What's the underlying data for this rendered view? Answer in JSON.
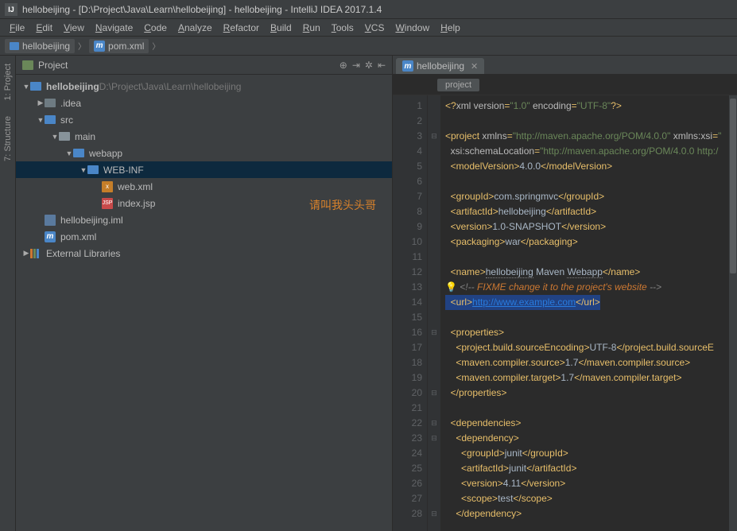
{
  "title": "hellobeijing - [D:\\Project\\Java\\Learn\\hellobeijing] - hellobeijing - IntelliJ IDEA 2017.1.4",
  "menu": [
    "File",
    "Edit",
    "View",
    "Navigate",
    "Code",
    "Analyze",
    "Refactor",
    "Build",
    "Run",
    "Tools",
    "VCS",
    "Window",
    "Help"
  ],
  "breadcrumbs": [
    {
      "icon": "dir",
      "label": "hellobeijing"
    },
    {
      "icon": "m",
      "label": "pom.xml"
    }
  ],
  "side_tabs": [
    "1: Project",
    "7: Structure"
  ],
  "panel": {
    "title": "Project"
  },
  "tree": [
    {
      "depth": 0,
      "arrow": "▼",
      "icon": "folder-blue",
      "label": "hellobeijing",
      "suffix": "D:\\Project\\Java\\Learn\\hellobeijing",
      "bold": true
    },
    {
      "depth": 1,
      "arrow": "▶",
      "icon": "folder-dark",
      "label": ".idea"
    },
    {
      "depth": 1,
      "arrow": "▼",
      "icon": "folder-blue",
      "label": "src"
    },
    {
      "depth": 2,
      "arrow": "▼",
      "icon": "folder",
      "label": "main"
    },
    {
      "depth": 3,
      "arrow": "▼",
      "icon": "folder-blue",
      "label": "webapp"
    },
    {
      "depth": 4,
      "arrow": "▼",
      "icon": "folder-blue",
      "label": "WEB-INF",
      "selected": true
    },
    {
      "depth": 5,
      "arrow": "",
      "icon": "xml",
      "label": "web.xml"
    },
    {
      "depth": 5,
      "arrow": "",
      "icon": "jsp",
      "label": "index.jsp"
    },
    {
      "depth": 1,
      "arrow": "",
      "icon": "iml",
      "label": "hellobeijing.iml"
    },
    {
      "depth": 1,
      "arrow": "",
      "icon": "m",
      "label": "pom.xml"
    },
    {
      "depth": 0,
      "arrow": "▶",
      "icon": "lib",
      "label": "External Libraries"
    }
  ],
  "watermark": "请叫我头头哥",
  "editor_tab": "hellobeijing",
  "crumb_pill": "project",
  "code_lines": [
    {
      "n": 1,
      "html": "<span class='t-tag'>&lt;?</span><span class='t-attr'>xml version</span><span class='t-tag'>=</span><span class='t-str'>\"1.0\"</span> <span class='t-attr'>encoding</span><span class='t-tag'>=</span><span class='t-str'>\"UTF-8\"</span><span class='t-tag'>?&gt;</span>"
    },
    {
      "n": 2,
      "html": ""
    },
    {
      "n": 3,
      "html": "<span class='t-tag'>&lt;project</span> <span class='t-attr'>xmlns</span><span class='t-tag'>=</span><span class='t-str'>\"http://maven.apache.org/POM/4.0.0\"</span> <span class='t-attr'>xmlns:xsi</span><span class='t-tag'>=</span><span class='t-str'>\"</span>",
      "fold": "⊟"
    },
    {
      "n": 4,
      "html": "  <span class='t-attr'>xsi:schemaLocation</span><span class='t-tag'>=</span><span class='t-str'>\"http://maven.apache.org/POM/4.0.0 http:/</span>"
    },
    {
      "n": 5,
      "html": "  <span class='t-tag'>&lt;modelVersion&gt;</span>4.0.0<span class='t-tag'>&lt;/modelVersion&gt;</span>"
    },
    {
      "n": 6,
      "html": ""
    },
    {
      "n": 7,
      "html": "  <span class='t-tag'>&lt;groupId&gt;</span>com.springmvc<span class='t-tag'>&lt;/groupId&gt;</span>"
    },
    {
      "n": 8,
      "html": "  <span class='t-tag'>&lt;artifactId&gt;</span>hellobeijing<span class='t-tag'>&lt;/artifactId&gt;</span>"
    },
    {
      "n": 9,
      "html": "  <span class='t-tag'>&lt;version&gt;</span>1.0-SNAPSHOT<span class='t-tag'>&lt;/version&gt;</span>"
    },
    {
      "n": 10,
      "html": "  <span class='t-tag'>&lt;packaging&gt;</span>war<span class='t-tag'>&lt;/packaging&gt;</span>"
    },
    {
      "n": 11,
      "html": ""
    },
    {
      "n": 12,
      "html": "  <span class='t-tag'>&lt;name&gt;</span><span style='border-bottom:1px dotted #808080'>hellobeijing</span> Maven <span style='border-bottom:1px dotted #808080'>Webapp</span><span class='t-tag'>&lt;/name&gt;</span>"
    },
    {
      "n": 13,
      "html": "<span class='bulb'>💡</span> <span class='t-comment'>&lt;!--</span> <span class='t-fix'>FIXME change it to the project's website</span> <span class='t-comment'>--&gt;</span>"
    },
    {
      "n": 14,
      "html": "<span class='hl-line'>  <span class='t-tag'>&lt;url&gt;</span><span class='t-url'>http://www.example.com</span><span class='t-tag'>&lt;/url&gt;</span></span>"
    },
    {
      "n": 15,
      "html": ""
    },
    {
      "n": 16,
      "html": "  <span class='t-tag'>&lt;properties&gt;</span>",
      "fold": "⊟"
    },
    {
      "n": 17,
      "html": "    <span class='t-tag'>&lt;project.build.sourceEncoding&gt;</span>UTF-8<span class='t-tag'>&lt;/project.build.sourceE</span>"
    },
    {
      "n": 18,
      "html": "    <span class='t-tag'>&lt;maven.compiler.source&gt;</span>1.7<span class='t-tag'>&lt;/maven.compiler.source&gt;</span>"
    },
    {
      "n": 19,
      "html": "    <span class='t-tag'>&lt;maven.compiler.target&gt;</span>1.7<span class='t-tag'>&lt;/maven.compiler.target&gt;</span>"
    },
    {
      "n": 20,
      "html": "  <span class='t-tag'>&lt;/properties&gt;</span>",
      "fold": "⊟"
    },
    {
      "n": 21,
      "html": ""
    },
    {
      "n": 22,
      "html": "  <span class='t-tag'>&lt;dependencies&gt;</span>",
      "fold": "⊟"
    },
    {
      "n": 23,
      "html": "    <span class='t-tag'>&lt;dependency&gt;</span>",
      "fold": "⊟"
    },
    {
      "n": 24,
      "html": "      <span class='t-tag'>&lt;groupId&gt;</span>junit<span class='t-tag'>&lt;/groupId&gt;</span>"
    },
    {
      "n": 25,
      "html": "      <span class='t-tag'>&lt;artifactId&gt;</span>junit<span class='t-tag'>&lt;/artifactId&gt;</span>"
    },
    {
      "n": 26,
      "html": "      <span class='t-tag'>&lt;version&gt;</span>4.11<span class='t-tag'>&lt;/version&gt;</span>"
    },
    {
      "n": 27,
      "html": "      <span class='t-tag'>&lt;scope&gt;</span>test<span class='t-tag'>&lt;/scope&gt;</span>"
    },
    {
      "n": 28,
      "html": "    <span class='t-tag'>&lt;/dependency&gt;</span>",
      "fold": "⊟"
    }
  ]
}
